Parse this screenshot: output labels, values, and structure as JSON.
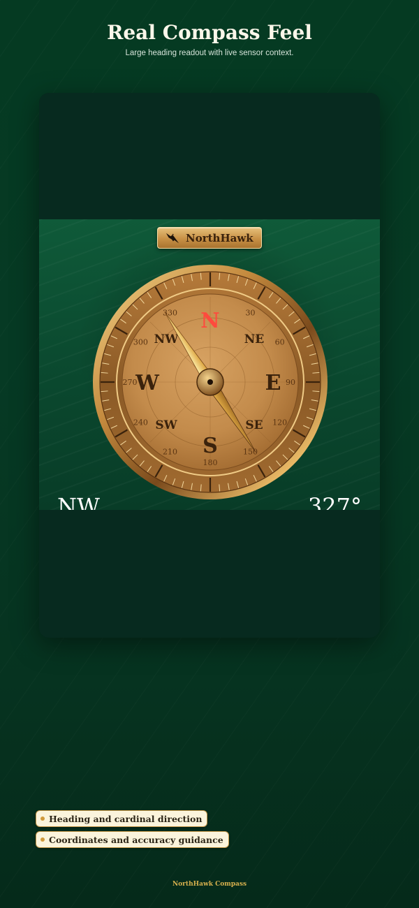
{
  "header": {
    "title": "Real Compass Feel",
    "subtitle": "Large heading readout with live sensor context."
  },
  "app": {
    "brand": "NorthHawk",
    "compass": {
      "heading_deg": 327,
      "cardinals": {
        "n": "N",
        "e": "E",
        "s": "S",
        "w": "W"
      },
      "intercardinals": {
        "ne": "NE",
        "se": "SE",
        "sw": "SW",
        "nw": "NW"
      },
      "degree_labels": [
        "30",
        "60",
        "90",
        "120",
        "150",
        "180",
        "210",
        "240",
        "270",
        "300",
        "330"
      ]
    },
    "readout": {
      "direction": "NW",
      "degrees": "327°"
    },
    "icons": {
      "brand": "hawk-icon"
    },
    "colors": {
      "north": "#ff4a3d",
      "gold": "#c89146",
      "background": "#063a24"
    }
  },
  "features": [
    {
      "label": "Heading and cardinal direction"
    },
    {
      "label": "Coordinates and accuracy guidance"
    }
  ],
  "footer": {
    "text": "NorthHawk Compass"
  }
}
